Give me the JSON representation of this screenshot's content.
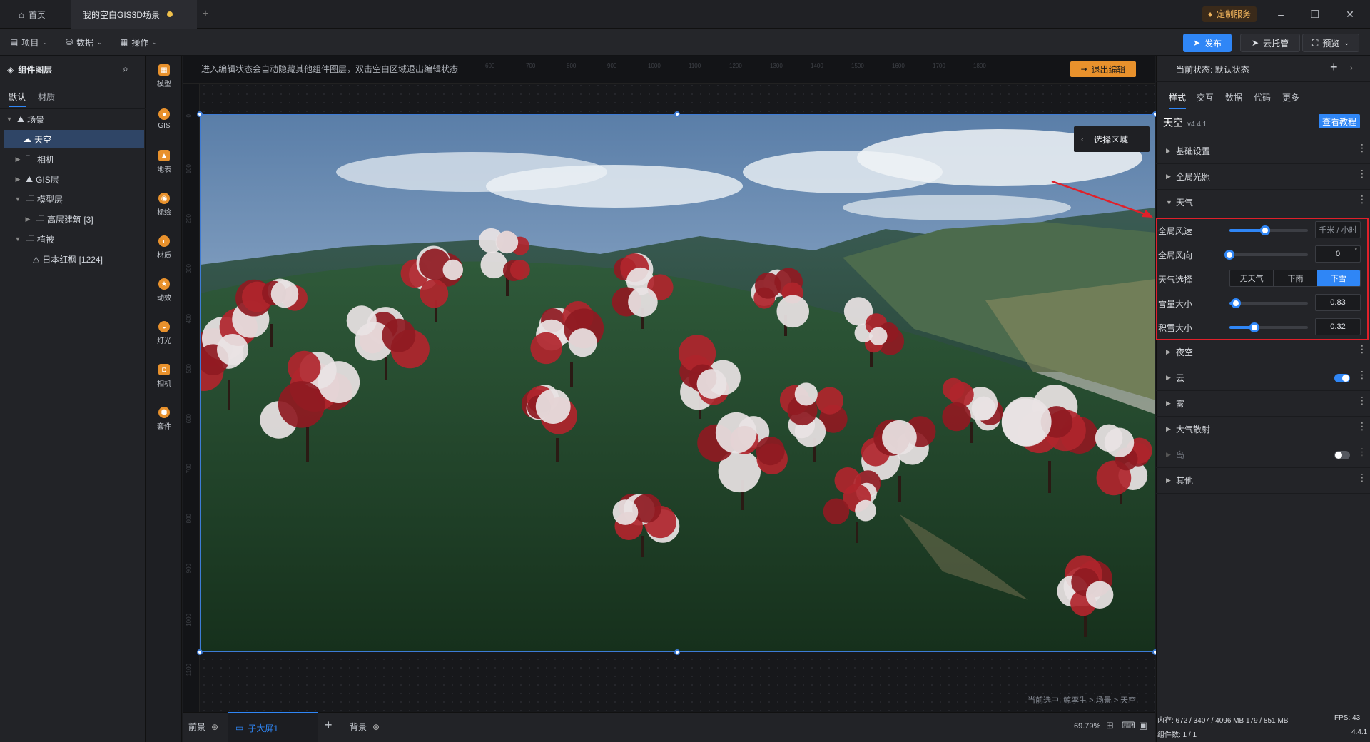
{
  "titlebar": {
    "home_label": "首页",
    "doc_tab_label": "我的空白GIS3D场景",
    "custom_service": "定制服务"
  },
  "toolbar": {
    "project": "项目",
    "data": "数据",
    "operate": "操作",
    "publish": "发布",
    "cloud": "云托管",
    "preview": "预览"
  },
  "layers": {
    "title": "组件图层",
    "tabs": [
      "默认",
      "材质"
    ],
    "tree": [
      {
        "label": "场景"
      },
      {
        "label": "天空"
      },
      {
        "label": "相机"
      },
      {
        "label": "GIS层"
      },
      {
        "label": "模型层"
      },
      {
        "label": "高层建筑 [3]"
      },
      {
        "label": "植被"
      },
      {
        "label": "日本红枫 [1224]"
      }
    ]
  },
  "rail": [
    "模型",
    "GIS",
    "地表",
    "标绘",
    "材质",
    "动效",
    "灯光",
    "相机",
    "套件"
  ],
  "canvas": {
    "hint": "进入编辑状态会自动隐藏其他组件图层，双击空白区域退出编辑状态",
    "exit_edit": "退出编辑",
    "select_area": "选择区域",
    "ruler_top": [
      "600",
      "700",
      "800",
      "900",
      "1000",
      "1100",
      "1200",
      "1300",
      "1400",
      "1500",
      "1600",
      "1700",
      "1800"
    ],
    "ruler_left": [
      "0",
      "100",
      "200",
      "300",
      "400",
      "500",
      "600",
      "700",
      "800",
      "900",
      "1000",
      "1100"
    ],
    "breadcrumb": "当前选中: 鲸孪生 > 场景 > 天空"
  },
  "bottom": {
    "front": "前景",
    "screen": "子大屏1",
    "back": "背景",
    "zoom": "69.79%"
  },
  "right": {
    "state_label": "当前状态: 默认状态",
    "tabs": [
      "样式",
      "交互",
      "数据",
      "代码",
      "更多"
    ],
    "component": "天空",
    "version": "v4.4.1",
    "tutorial": "查看教程",
    "sections_top": [
      "基础设置",
      "全局光照",
      "天气"
    ],
    "props": {
      "wind_speed": {
        "label": "全局风速",
        "unit": "千米 / 小时",
        "value": 0.45
      },
      "wind_dir": {
        "label": "全局风向",
        "value_text": "0",
        "suffix": "°",
        "value": 0.0
      },
      "weather": {
        "label": "天气选择",
        "options": [
          "无天气",
          "下雨",
          "下雪"
        ],
        "selected": "下雪"
      },
      "snow_size": {
        "label": "雪量大小",
        "value_text": "0.83",
        "value": 0.08
      },
      "snow_cover": {
        "label": "积雪大小",
        "value_text": "0.32",
        "value": 0.32
      }
    },
    "sections_bottom": [
      {
        "label": "夜空",
        "toggle": null
      },
      {
        "label": "云",
        "toggle": "on"
      },
      {
        "label": "雾",
        "toggle": null
      },
      {
        "label": "大气散射",
        "toggle": null
      },
      {
        "label": "岛",
        "toggle": "off"
      },
      {
        "label": "其他",
        "toggle": null
      }
    ],
    "status": {
      "memory": "内存: 672 / 3407 / 4096 MB  179 / 851 MB",
      "fps": "FPS: 43",
      "count": "组件数: 1 / 1",
      "ver": "4.4.1"
    }
  },
  "colors": {
    "accent": "#2f86f6",
    "highlight_box": "#e0202a",
    "exit_btn": "#e8912c"
  }
}
